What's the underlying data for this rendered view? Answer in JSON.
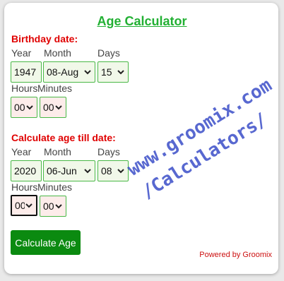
{
  "title": "Age Calculator",
  "birthday": {
    "heading": "Birthday date:",
    "year_label": "Year",
    "month_label": "Month",
    "days_label": "Days",
    "hours_label": "Hours",
    "minutes_label": "Minutes",
    "year_value": "1947",
    "month_value": "08-Aug",
    "day_value": "15",
    "hours_value": "00",
    "minutes_value": "00"
  },
  "till": {
    "heading": "Calculate age till date:",
    "year_label": "Year",
    "month_label": "Month",
    "days_label": "Days",
    "hours_label": "Hours",
    "minutes_label": "Minutes",
    "year_value": "2020",
    "month_value": "06-Jun",
    "day_value": "08",
    "hours_value": "00",
    "minutes_value": "00"
  },
  "button_label": "Calculate Age",
  "powered_by": "Powered by Groomix",
  "watermark": {
    "line1": "www.groomix.com",
    "line2": "/Calculators/"
  },
  "colors": {
    "title": "#22b033",
    "heading": "#e00000",
    "button": "#0b8a10",
    "watermark": "#3b4ec8"
  }
}
